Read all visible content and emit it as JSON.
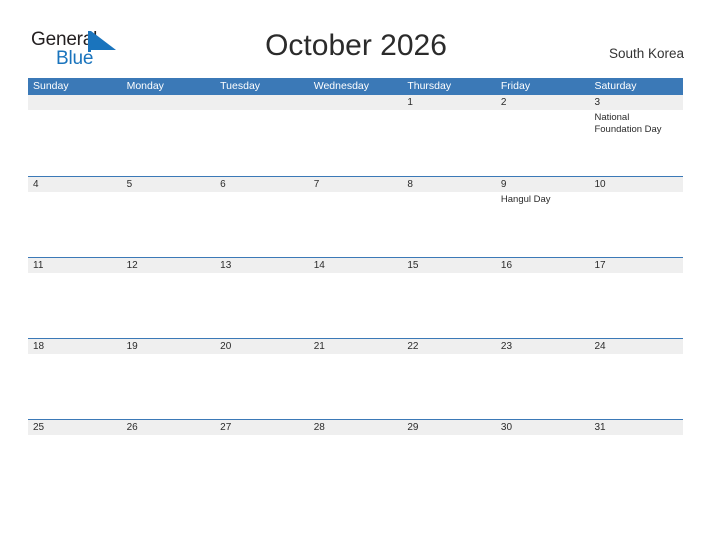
{
  "brand": {
    "word1": "General",
    "word2": "Blue",
    "flag_color": "#1a74bd",
    "word1_color": "#231f20",
    "word2_color": "#1a74bd"
  },
  "header": {
    "title": "October 2026",
    "region": "South Korea"
  },
  "theme": {
    "header_blue": "#3b79b7",
    "band_gray": "#efefef",
    "text_dark": "#2b2b2b"
  },
  "calendar": {
    "weekdays": [
      "Sunday",
      "Monday",
      "Tuesday",
      "Wednesday",
      "Thursday",
      "Friday",
      "Saturday"
    ],
    "weeks": [
      [
        {
          "num": "",
          "events": []
        },
        {
          "num": "",
          "events": []
        },
        {
          "num": "",
          "events": []
        },
        {
          "num": "",
          "events": []
        },
        {
          "num": "1",
          "events": []
        },
        {
          "num": "2",
          "events": []
        },
        {
          "num": "3",
          "events": [
            "National",
            "Foundation Day"
          ]
        }
      ],
      [
        {
          "num": "4",
          "events": []
        },
        {
          "num": "5",
          "events": []
        },
        {
          "num": "6",
          "events": []
        },
        {
          "num": "7",
          "events": []
        },
        {
          "num": "8",
          "events": []
        },
        {
          "num": "9",
          "events": [
            "Hangul Day"
          ]
        },
        {
          "num": "10",
          "events": []
        }
      ],
      [
        {
          "num": "11",
          "events": []
        },
        {
          "num": "12",
          "events": []
        },
        {
          "num": "13",
          "events": []
        },
        {
          "num": "14",
          "events": []
        },
        {
          "num": "15",
          "events": []
        },
        {
          "num": "16",
          "events": []
        },
        {
          "num": "17",
          "events": []
        }
      ],
      [
        {
          "num": "18",
          "events": []
        },
        {
          "num": "19",
          "events": []
        },
        {
          "num": "20",
          "events": []
        },
        {
          "num": "21",
          "events": []
        },
        {
          "num": "22",
          "events": []
        },
        {
          "num": "23",
          "events": []
        },
        {
          "num": "24",
          "events": []
        }
      ],
      [
        {
          "num": "25",
          "events": []
        },
        {
          "num": "26",
          "events": []
        },
        {
          "num": "27",
          "events": []
        },
        {
          "num": "28",
          "events": []
        },
        {
          "num": "29",
          "events": []
        },
        {
          "num": "30",
          "events": []
        },
        {
          "num": "31",
          "events": []
        }
      ]
    ]
  }
}
